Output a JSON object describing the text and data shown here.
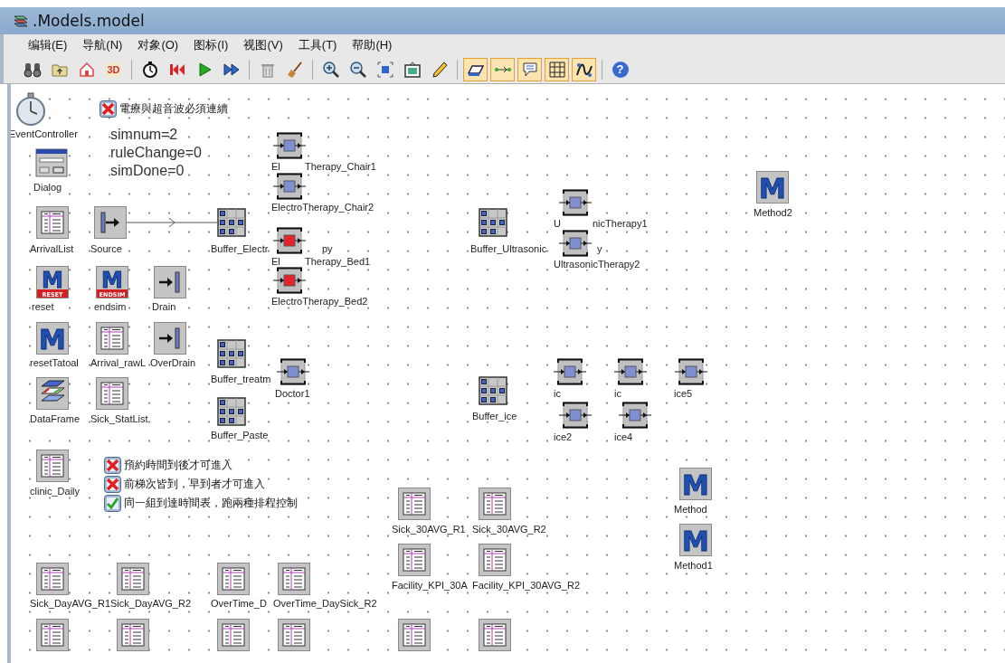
{
  "window": {
    "title": ".Models.model"
  },
  "menu": [
    "编辑(E)",
    "导航(N)",
    "对象(O)",
    "图标(I)",
    "视图(V)",
    "工具(T)",
    "帮助(H)"
  ],
  "toolbar": [
    {
      "kind": "binoculars"
    },
    {
      "kind": "folder"
    },
    {
      "kind": "home"
    },
    {
      "kind": "view3d",
      "label": "3D"
    },
    {
      "kind": "separator"
    },
    {
      "kind": "stopwatch"
    },
    {
      "kind": "reset"
    },
    {
      "kind": "play"
    },
    {
      "kind": "fast"
    },
    {
      "kind": "separator"
    },
    {
      "kind": "delete"
    },
    {
      "kind": "broom"
    },
    {
      "kind": "separator"
    },
    {
      "kind": "zoom-in"
    },
    {
      "kind": "zoom-out"
    },
    {
      "kind": "fit"
    },
    {
      "kind": "frame"
    },
    {
      "kind": "pencil"
    },
    {
      "kind": "separator"
    },
    {
      "kind": "prism",
      "on": true
    },
    {
      "kind": "connector",
      "on": true
    },
    {
      "kind": "bubble",
      "on": true
    },
    {
      "kind": "grid",
      "on": true
    },
    {
      "kind": "curve",
      "on": true
    },
    {
      "kind": "separator"
    },
    {
      "kind": "help",
      "label": "?"
    }
  ],
  "objects": [
    {
      "kind": "stopwatch",
      "label": "EventController"
    },
    {
      "kind": "checkbox",
      "checked": false,
      "label": "電療與超音波必須連續"
    },
    {
      "kind": "variables",
      "lines": [
        "simnum=2",
        "ruleChange=0",
        "simDone=0"
      ]
    },
    {
      "kind": "station",
      "color": "#7f8fd0",
      "label": "El",
      "label_tail": "Therapy_Chair1"
    },
    {
      "kind": "dialog",
      "label": "Dialog"
    },
    {
      "kind": "station",
      "color": "#7f8fd0",
      "label": "ElectroTherapy_Chair2"
    },
    {
      "kind": "method",
      "glyph": "M",
      "label": "Method2"
    },
    {
      "kind": "station",
      "color": "#7f8fd0",
      "label": "U",
      "label_tail": "nicTherapy1"
    },
    {
      "kind": "table",
      "label": "ArrivalList"
    },
    {
      "kind": "source",
      "label": "Source"
    },
    {
      "kind": "buffer",
      "label": "Buffer_Electr",
      "label_tail": "py"
    },
    {
      "kind": "buffer",
      "label": "Buffer_Ultrasonic",
      "label_tail": "y"
    },
    {
      "kind": "station",
      "color": "#e8232b",
      "label": "El",
      "label_tail": "Therapy_Bed1"
    },
    {
      "kind": "station",
      "color": "#7f8fd0",
      "label": "UltrasonicTherapy2"
    },
    {
      "kind": "method",
      "glyph": "M",
      "badge": "RESET",
      "label": "reset"
    },
    {
      "kind": "method",
      "glyph": "M",
      "badge": "ENDSIM",
      "label": "endsim"
    },
    {
      "kind": "drain",
      "label": "Drain"
    },
    {
      "kind": "station",
      "color": "#e8232b",
      "label": "ElectroTherapy_Bed2"
    },
    {
      "kind": "method",
      "glyph": "M",
      "label": "resetTatoal"
    },
    {
      "kind": "table",
      "label": "Arrival_rawL"
    },
    {
      "kind": "drain",
      "label": "OverDrain"
    },
    {
      "kind": "buffer",
      "label": "Buffer_treatm"
    },
    {
      "kind": "station",
      "color": "#7f8fd0",
      "label": "Doctor1"
    },
    {
      "kind": "station",
      "color": "#7f8fd0",
      "label": "ic"
    },
    {
      "kind": "station",
      "color": "#7f8fd0",
      "label": "ic"
    },
    {
      "kind": "station",
      "color": "#7f8fd0",
      "label": "ice5"
    },
    {
      "kind": "dataframe",
      "label": "DataFrame"
    },
    {
      "kind": "table",
      "label": "Sick_StatList"
    },
    {
      "kind": "buffer",
      "label": "Buffer_ice"
    },
    {
      "kind": "buffer",
      "label": "Buffer_Paste"
    },
    {
      "kind": "station",
      "color": "#7f8fd0",
      "label": "ice2"
    },
    {
      "kind": "station",
      "color": "#7f8fd0",
      "label": "ice4"
    },
    {
      "kind": "table",
      "label": "clinic_Daily"
    },
    {
      "kind": "checkbox",
      "checked": false,
      "label": "預約時間到後才可進入"
    },
    {
      "kind": "checkbox",
      "checked": false,
      "label": "前梯次皆到，早到者才可進入"
    },
    {
      "kind": "checkbox",
      "checked": true,
      "label": "同一組到達時間表，跑兩種排程控制"
    },
    {
      "kind": "table",
      "label": "Sick_30AVG_R1"
    },
    {
      "kind": "table",
      "label": "Sick_30AVG_R2"
    },
    {
      "kind": "method",
      "glyph": "M",
      "label": "Method"
    },
    {
      "kind": "table",
      "label": "Facility_KPI_30A"
    },
    {
      "kind": "table",
      "label": "Facility_KPI_30AVG_R2"
    },
    {
      "kind": "method",
      "glyph": "M",
      "label": "Method1"
    },
    {
      "kind": "table",
      "label": "Sick_DayAVG_R1"
    },
    {
      "kind": "table",
      "label": "Sick_DayAVG_R2"
    },
    {
      "kind": "table",
      "label": "OverTime_D"
    },
    {
      "kind": "table",
      "label": "OverTime_DaySick_R2"
    },
    {
      "kind": "table"
    },
    {
      "kind": "table"
    },
    {
      "kind": "table"
    },
    {
      "kind": "table"
    },
    {
      "kind": "table"
    },
    {
      "kind": "table"
    }
  ]
}
